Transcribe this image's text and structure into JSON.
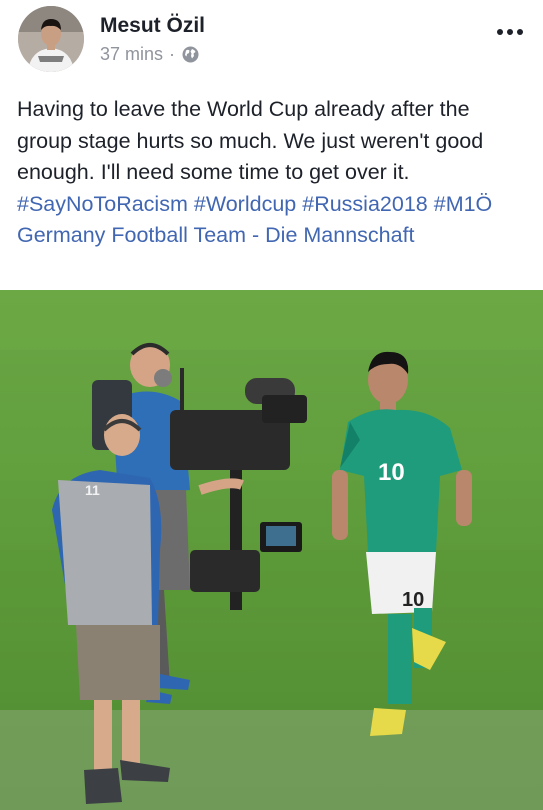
{
  "post": {
    "author": "Mesut Özil",
    "time": "37 mins",
    "separator": "·",
    "audience_icon": "globe-icon",
    "menu_icon": "more-options-icon",
    "text": "Having to leave the World Cup already after the group stage hurts so much. We just weren't good enough. I'll need some time to get over it.",
    "hashtags": [
      "#SayNoToRacism",
      "#Worldcup",
      "#Russia2018",
      "#M1Ö"
    ],
    "tagged_page": "Germany Football Team - Die Mannschaft"
  },
  "photo": {
    "jersey_number": "10",
    "vest_text": "11"
  },
  "colors": {
    "text": "#1d2129",
    "secondary_text": "#90949c",
    "link": "#4267b2",
    "pitch": "#5e9a3c",
    "jersey": "#1f9c7c"
  }
}
